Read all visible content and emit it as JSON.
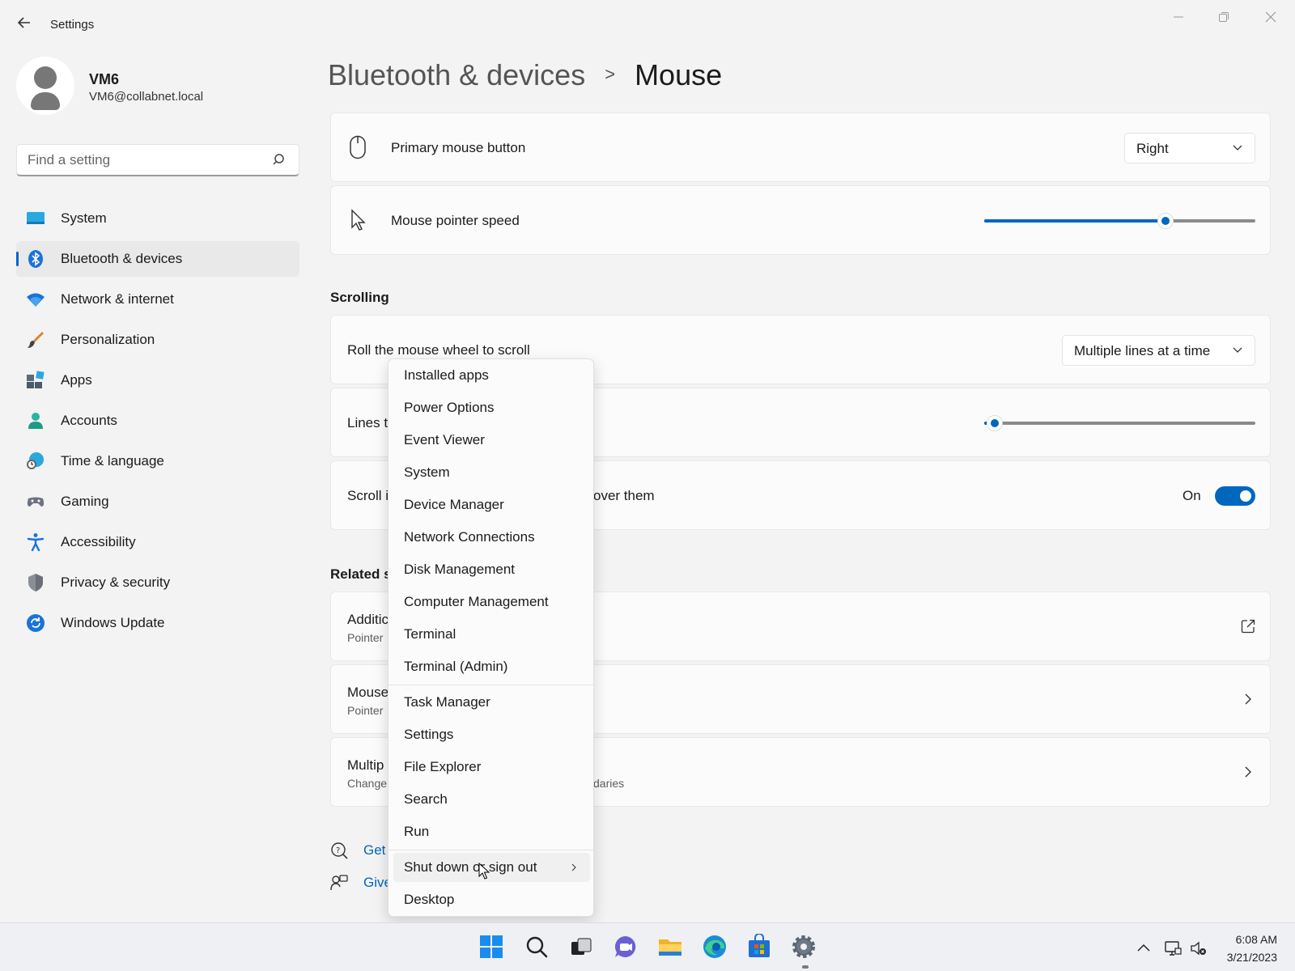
{
  "window": {
    "title": "Settings",
    "back_icon": "back-arrow-icon"
  },
  "profile": {
    "name": "VM6",
    "email": "VM6@collabnet.local"
  },
  "search": {
    "placeholder": "Find a setting"
  },
  "sidebar": {
    "items": [
      {
        "label": "System",
        "icon": "system-icon",
        "active": false
      },
      {
        "label": "Bluetooth & devices",
        "icon": "bluetooth-icon",
        "active": true
      },
      {
        "label": "Network & internet",
        "icon": "wifi-icon",
        "active": false
      },
      {
        "label": "Personalization",
        "icon": "brush-icon",
        "active": false
      },
      {
        "label": "Apps",
        "icon": "apps-icon",
        "active": false
      },
      {
        "label": "Accounts",
        "icon": "accounts-icon",
        "active": false
      },
      {
        "label": "Time & language",
        "icon": "globe-clock-icon",
        "active": false
      },
      {
        "label": "Gaming",
        "icon": "gamepad-icon",
        "active": false
      },
      {
        "label": "Accessibility",
        "icon": "accessibility-icon",
        "active": false
      },
      {
        "label": "Privacy & security",
        "icon": "shield-icon",
        "active": false
      },
      {
        "label": "Windows Update",
        "icon": "update-icon",
        "active": false
      }
    ]
  },
  "breadcrumb": {
    "parent": "Bluetooth & devices",
    "separator": ">",
    "current": "Mouse"
  },
  "main": {
    "primary_button": {
      "label": "Primary mouse button",
      "value": "Right"
    },
    "pointer_speed": {
      "label": "Mouse pointer speed",
      "level": 0.67
    },
    "scrolling": {
      "title": "Scrolling",
      "roll": {
        "label": "Roll the mouse wheel to scroll",
        "value": "Multiple lines at a time"
      },
      "lines_label": "Lines t",
      "lines_level": 0.04,
      "inactive": {
        "label_start": "Scroll i",
        "label_end": "over them",
        "state": "On"
      }
    },
    "related": {
      "title": "Related s",
      "items": [
        {
          "label": "Additic",
          "sub": "Pointer"
        },
        {
          "label": "Mouse",
          "sub": "Pointer"
        },
        {
          "label": "Multip",
          "sub": "Change",
          "sub_end": "daries"
        }
      ]
    },
    "links": {
      "get_help": "Get",
      "give_feedback": "Give"
    }
  },
  "context_menu": {
    "items": [
      "Installed apps",
      "Power Options",
      "Event Viewer",
      "System",
      "Device Manager",
      "Network Connections",
      "Disk Management",
      "Computer Management",
      "Terminal",
      "Terminal (Admin)",
      "Task Manager",
      "Settings",
      "File Explorer",
      "Search",
      "Run",
      "Shut down or sign out",
      "Desktop"
    ]
  },
  "taskbar": {
    "time": "6:08 AM",
    "date": "3/21/2023",
    "apps": [
      "windows-start-icon",
      "search-icon",
      "task-view-icon",
      "chat-icon",
      "file-explorer-icon",
      "edge-icon",
      "store-icon",
      "settings-gear-icon"
    ]
  },
  "colors": {
    "accent": "#0067c0",
    "background": "#f3f3f3",
    "card": "#fbfbfb"
  }
}
